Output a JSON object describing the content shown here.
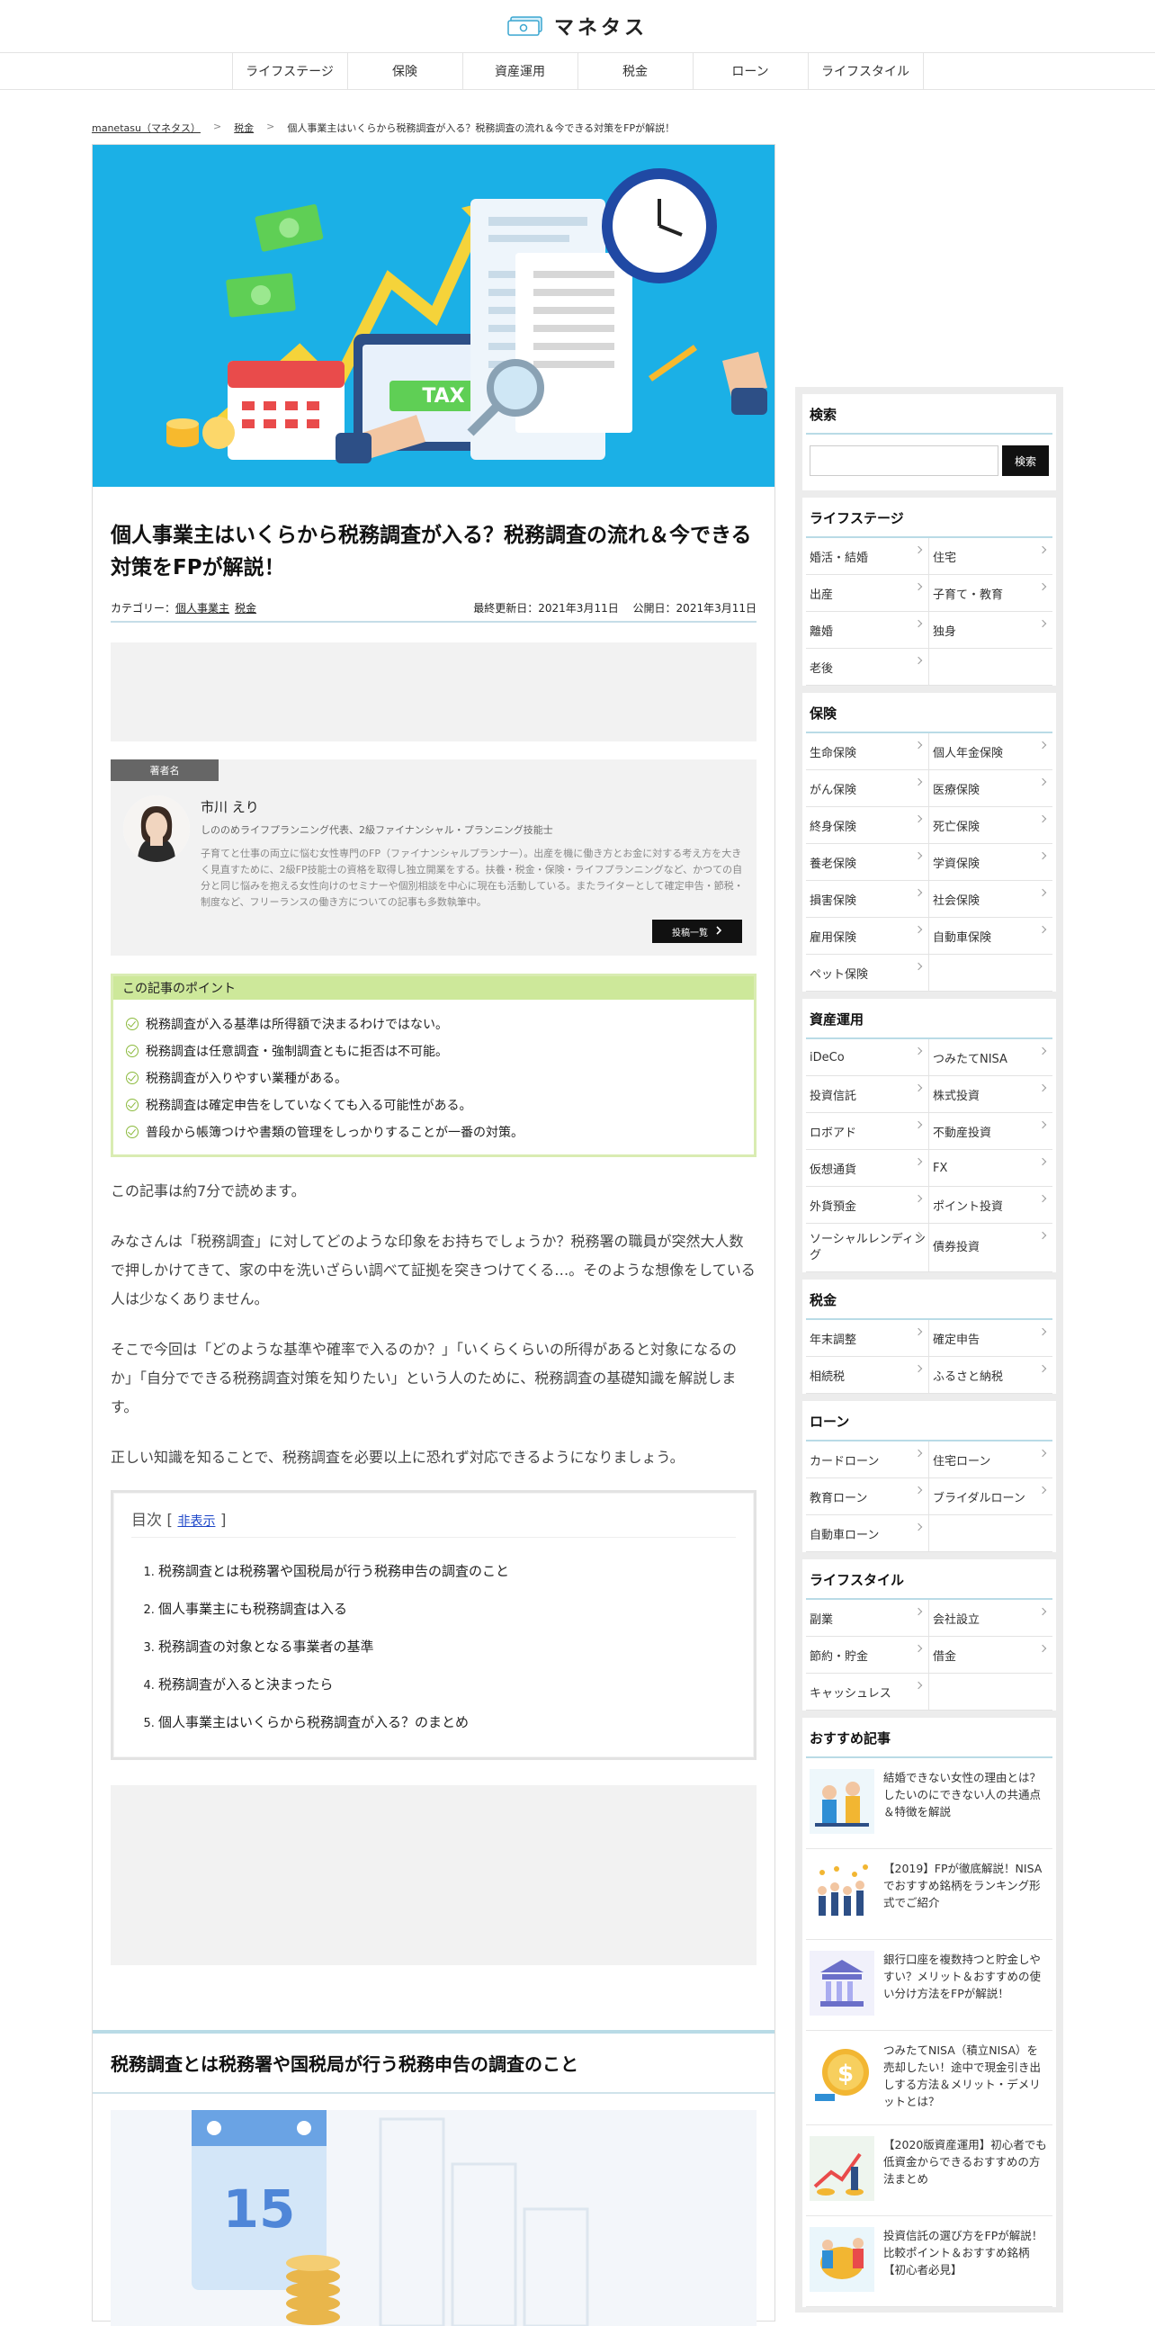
{
  "header": {
    "logo_text": "マネタス"
  },
  "nav": [
    "ライフステージ",
    "保険",
    "資産運用",
    "税金",
    "ローン",
    "ライフスタイル"
  ],
  "breadcrumb": {
    "home": "manetasu（マネタス）",
    "category": "税金",
    "current": "個人事業主はいくらから税務調査が入る？税務調査の流れ＆今できる対策をFPが解説！"
  },
  "hero": {
    "tax_label": "TAX"
  },
  "article": {
    "title": "個人事業主はいくらから税務調査が入る？税務調査の流れ＆今できる対策をFPが解説！",
    "category_label": "カテゴリー：",
    "categories": [
      "個人事業主",
      "税金"
    ],
    "updated": "最終更新日：2021年3月11日",
    "published": "公開日：2021年3月11日",
    "author": {
      "tag": "著者名",
      "name": "市川 えり",
      "title": "しののめライフプランニング代表、2級ファイナンシャル・プランニング技能士",
      "desc": "子育てと仕事の両立に悩む女性専門のFP（ファイナンシャルプランナー）。出産を機に働き方とお金に対する考え方を大きく見直すために、2級FP技能士の資格を取得し独立開業をする。扶養・税金・保険・ライフプランニングなど、かつての自分と同じ悩みを抱える女性向けのセミナーや個別相談を中心に現在も活動している。またライターとして確定申告・節税・制度など、フリーランスの働き方についての記事も多数執筆中。",
      "button": "投稿一覧"
    },
    "points": {
      "head": "この記事のポイント",
      "items": [
        "税務調査が入る基準は所得額で決まるわけではない。",
        "税務調査は任意調査・強制調査ともに拒否は不可能。",
        "税務調査が入りやすい業種がある。",
        "税務調査は確定申告をしていなくても入る可能性がある。",
        "普段から帳簿つけや書類の管理をしっかりすることが一番の対策。"
      ]
    },
    "paragraphs": [
      "この記事は約7分で読めます。",
      "みなさんは「税務調査」に対してどのような印象をお持ちでしょうか？税務署の職員が突然大人数で押しかけてきて、家の中を洗いざらい調べて証拠を突きつけてくる…。そのような想像をしている人は少なくありません。",
      "そこで今回は「どのような基準や確率で入るのか？」「いくらくらいの所得があると対象になるのか」「自分でできる税務調査対策を知りたい」という人のために、税務調査の基礎知識を解説します。",
      "正しい知識を知ることで、税務調査を必要以上に恐れず対応できるようになりましょう。"
    ],
    "toc": {
      "title": "目次",
      "toggle": "非表示",
      "items": [
        "税務調査とは税務署や国税局が行う税務申告の調査のこと",
        "個人事業主にも税務調査は入る",
        "税務調査の対象となる事業者の基準",
        "税務調査が入ると決まったら",
        "個人事業主はいくらから税務調査が入る？のまとめ"
      ]
    },
    "section1_title": "税務調査とは税務署や国税局が行う税務申告の調査のこと",
    "section1_img_text": "15"
  },
  "sidebar": {
    "search": {
      "title": "検索",
      "button": "検索",
      "placeholder": ""
    },
    "lifestage": {
      "title": "ライフステージ",
      "items": [
        "婚活・結婚",
        "住宅",
        "出産",
        "子育て・教育",
        "離婚",
        "独身",
        "老後",
        ""
      ]
    },
    "insurance": {
      "title": "保険",
      "items": [
        "生命保険",
        "個人年金保険",
        "がん保険",
        "医療保険",
        "終身保険",
        "死亡保険",
        "養老保険",
        "学資保険",
        "損害保険",
        "社会保険",
        "雇用保険",
        "自動車保険",
        "ペット保険",
        ""
      ]
    },
    "investment": {
      "title": "資産運用",
      "items": [
        "iDeCo",
        "つみたてNISA",
        "投資信託",
        "株式投資",
        "ロボアド",
        "不動産投資",
        "仮想通貨",
        "FX",
        "外貨預金",
        "ポイント投資",
        "ソーシャルレンディング",
        "債券投資"
      ]
    },
    "tax": {
      "title": "税金",
      "items": [
        "年末調整",
        "確定申告",
        "相続税",
        "ふるさと納税"
      ]
    },
    "loan": {
      "title": "ローン",
      "items": [
        "カードローン",
        "住宅ローン",
        "教育ローン",
        "ブライダルローン",
        "自動車ローン",
        ""
      ]
    },
    "lifestyle": {
      "title": "ライフスタイル",
      "items": [
        "副業",
        "会社設立",
        "節約・貯金",
        "借金",
        "キャッシュレス",
        ""
      ]
    },
    "recommended": {
      "title": "おすすめ記事",
      "items": [
        "結婚できない女性の理由とは？したいのにできない人の共通点＆特徴を解説",
        "【2019】FPが徹底解説！NISAでおすすめ銘柄をランキング形式でご紹介",
        "銀行口座を複数持つと貯金しやすい？メリット＆おすすめの使い分け方法をFPが解説！",
        "つみたてNISA（積立NISA）を売却したい！途中で現金引き出しする方法＆メリット・デメリットとは？",
        "【2020版資産運用】初心者でも低資金からできるおすすめの方法まとめ",
        "投資信託の選び方をFPが解説！比較ポイント＆おすすめ銘柄【初心者必見】"
      ]
    }
  }
}
